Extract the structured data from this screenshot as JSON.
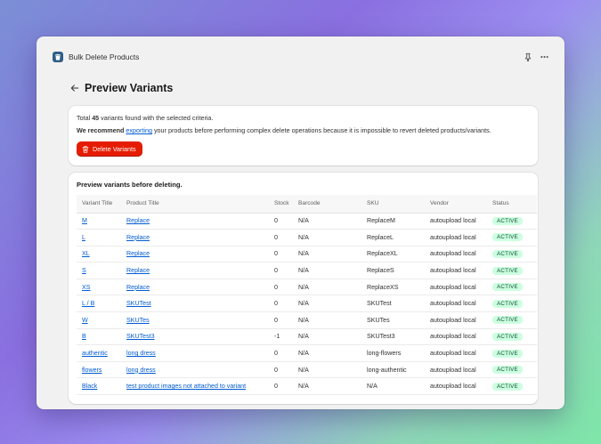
{
  "app": {
    "title": "Bulk Delete Products",
    "icon": "trash-icon"
  },
  "titlebar": {
    "pin_icon": "pin-icon",
    "more_icon": "more-horizontal-icon"
  },
  "page": {
    "title": "Preview Variants",
    "back_icon": "arrow-left-icon"
  },
  "info": {
    "total_prefix": "Total ",
    "total_count": "45",
    "total_suffix": " variants found with the selected criteria.",
    "recommend_bold": "We recommend",
    "recommend_link": "exporting",
    "recommend_rest": " your products before performing complex delete operations because it is impossible to revert deleted products/variants.",
    "delete_button": "Delete Variants"
  },
  "table": {
    "title": "Preview variants before deleting.",
    "columns": [
      "Variant Title",
      "Product Title",
      "Stock",
      "Barcode",
      "SKU",
      "Vendor",
      "Status"
    ],
    "rows": [
      {
        "variant": "M",
        "product": "Replace",
        "stock": "0",
        "barcode": "N/A",
        "sku": "ReplaceM",
        "vendor": "autoupload local",
        "status": "ACTIVE"
      },
      {
        "variant": "L",
        "product": "Replace",
        "stock": "0",
        "barcode": "N/A",
        "sku": "ReplaceL",
        "vendor": "autoupload local",
        "status": "ACTIVE"
      },
      {
        "variant": "XL",
        "product": "Replace",
        "stock": "0",
        "barcode": "N/A",
        "sku": "ReplaceXL",
        "vendor": "autoupload local",
        "status": "ACTIVE"
      },
      {
        "variant": "S",
        "product": "Replace",
        "stock": "0",
        "barcode": "N/A",
        "sku": "ReplaceS",
        "vendor": "autoupload local",
        "status": "ACTIVE"
      },
      {
        "variant": "XS",
        "product": "Replace",
        "stock": "0",
        "barcode": "N/A",
        "sku": "ReplaceXS",
        "vendor": "autoupload local",
        "status": "ACTIVE"
      },
      {
        "variant": "L / B",
        "product": "SKUTest",
        "stock": "0",
        "barcode": "N/A",
        "sku": "SKUTest",
        "vendor": "autoupload local",
        "status": "ACTIVE"
      },
      {
        "variant": "W",
        "product": "SKUTes",
        "stock": "0",
        "barcode": "N/A",
        "sku": "SKUTes",
        "vendor": "autoupload local",
        "status": "ACTIVE"
      },
      {
        "variant": "B",
        "product": "SKUTest3",
        "stock": "-1",
        "barcode": "N/A",
        "sku": "SKUTest3",
        "vendor": "autoupload local",
        "status": "ACTIVE"
      },
      {
        "variant": "authentic",
        "product": "long dress",
        "stock": "0",
        "barcode": "N/A",
        "sku": "long-flowers",
        "vendor": "autoupload local",
        "status": "ACTIVE"
      },
      {
        "variant": "flowers",
        "product": "long dress",
        "stock": "0",
        "barcode": "N/A",
        "sku": "long-authentic",
        "vendor": "autoupload local",
        "status": "ACTIVE"
      },
      {
        "variant": "Black",
        "product": "test product images not attached to variant",
        "stock": "0",
        "barcode": "N/A",
        "sku": "N/A",
        "vendor": "autoupload local",
        "status": "ACTIVE"
      },
      {
        "variant": "",
        "product": "",
        "stock": "",
        "barcode": "",
        "sku": "",
        "vendor": "",
        "status": ""
      }
    ]
  },
  "colors": {
    "accent_link": "#005bd3",
    "danger": "#e51c00",
    "badge_bg": "#cdfee1",
    "badge_text": "#0c5132"
  }
}
